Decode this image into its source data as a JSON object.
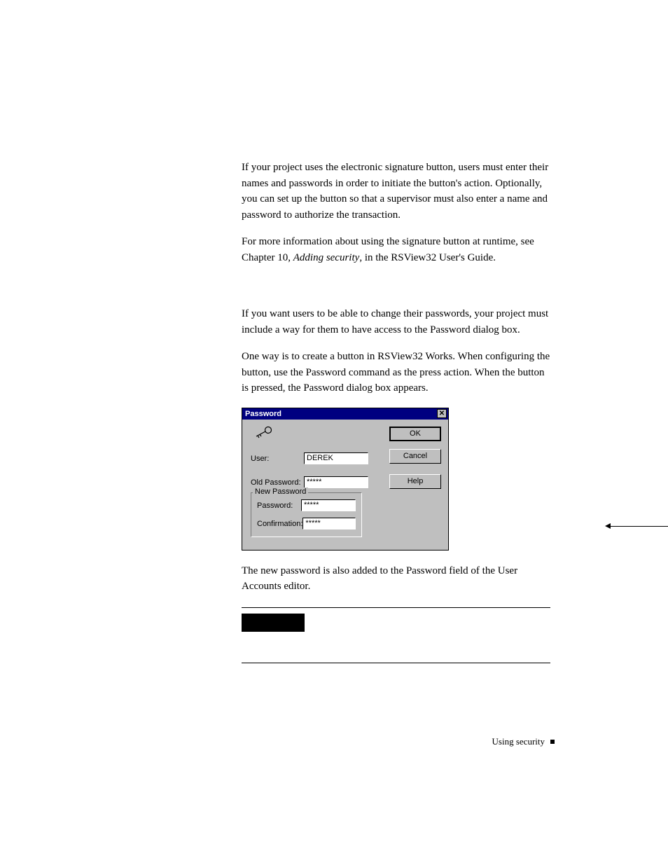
{
  "body": {
    "p1": "If your project uses the electronic signature button, users must enter their names and passwords in order to initiate the button's action. Optionally, you can set up the button so that a supervisor must also enter a name and password to authorize the transaction.",
    "p2a": "For more information about using the signature button at runtime, see Chapter 10, ",
    "p2b": "Adding security",
    "p2c": ", in the RSView32 User's Guide.",
    "p3": "If you want users to be able to change their passwords, your project must include a way for them to have access to the Password dialog box.",
    "p4": "One way is to create a button in RSView32 Works. When configuring the button, use the Password command as the press action. When the button is pressed, the Password dialog box appears.",
    "p5": "The new password is also added to the Password field of the User Accounts editor."
  },
  "dialog": {
    "title": "Password",
    "close": "✕",
    "user_label": "User:",
    "user_value": "DEREK",
    "old_label": "Old Password:",
    "old_value": "*****",
    "group_legend": "New Password",
    "pw_label": "Password:",
    "pw_value": "*****",
    "conf_label": "Confirmation:",
    "conf_value": "*****",
    "ok": "OK",
    "cancel": "Cancel",
    "help": "Help"
  },
  "footer": {
    "text": "Using security"
  }
}
